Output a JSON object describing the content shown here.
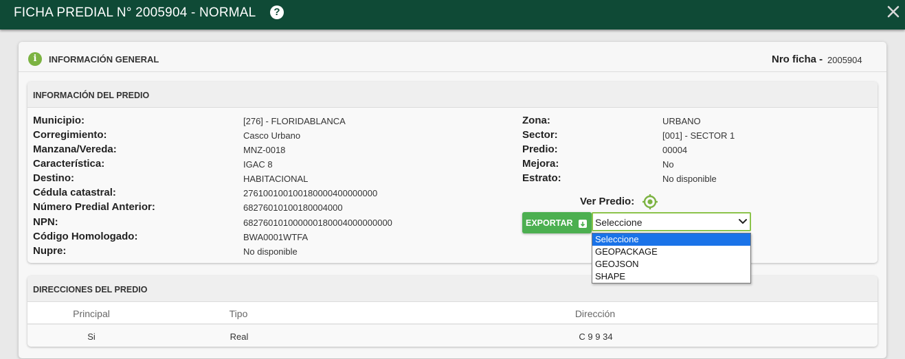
{
  "window": {
    "title": "FICHA PREDIAL N° 2005904 - NORMAL",
    "help_icon": "?",
    "close_icon": "close-icon"
  },
  "general": {
    "title": "INFORMACIÓN GENERAL",
    "info_icon": "i",
    "nro_ficha_label": "Nro ficha -",
    "nro_ficha_value": "2005904"
  },
  "predio": {
    "title": "INFORMACIÓN DEL PREDIO",
    "left_fields": [
      {
        "label": "Municipio:",
        "value": "[276] - FLORIDABLANCA"
      },
      {
        "label": "Corregimiento:",
        "value": "Casco Urbano"
      },
      {
        "label": "Manzana/Vereda:",
        "value": "MNZ-0018"
      },
      {
        "label": "Característica:",
        "value": "IGAC 8"
      },
      {
        "label": "Destino:",
        "value": "HABITACIONAL"
      },
      {
        "label": "Cédula catastral:",
        "value": "276100100100180000400000000"
      },
      {
        "label": "Número Predial Anterior:",
        "value": "68276010100180004000"
      },
      {
        "label": "NPN:",
        "value": "682760101000000180004000000000"
      },
      {
        "label": "Código Homologado:",
        "value": "BWA0001WTFA"
      },
      {
        "label": "Nupre:",
        "value": "No disponible"
      }
    ],
    "right_fields": [
      {
        "label": "Zona:",
        "value": "URBANO"
      },
      {
        "label": "Sector:",
        "value": "[001] - SECTOR 1"
      },
      {
        "label": "Predio:",
        "value": "00004"
      },
      {
        "label": "Mejora:",
        "value": "No"
      },
      {
        "label": "Estrato:",
        "value": "No disponible"
      }
    ],
    "ver_predio_label": "Ver Predio:",
    "export_button_label": "EXPORTAR",
    "export_select": {
      "selected": "Seleccione",
      "options": [
        "Seleccione",
        "GEOPACKAGE",
        "GEOJSON",
        "SHAPE"
      ]
    }
  },
  "direcciones": {
    "title": "DIRECCIONES DEL PREDIO",
    "columns": [
      "Principal",
      "Tipo",
      "Dirección"
    ],
    "rows": [
      [
        "Si",
        "Real",
        "C 9 9 34"
      ]
    ]
  },
  "colors": {
    "title_bar": "#0f4a36",
    "accent_green": "#4caf50",
    "select_border": "#8bc34a",
    "option_highlight": "#1a73e8"
  }
}
